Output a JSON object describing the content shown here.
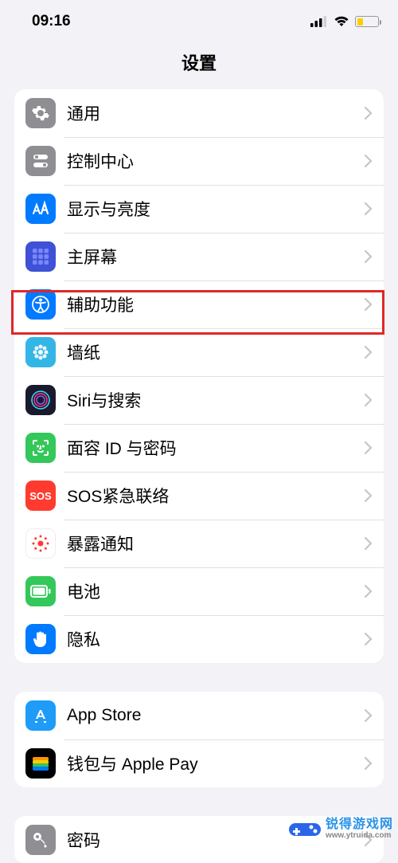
{
  "status": {
    "time": "09:16"
  },
  "header": {
    "title": "设置"
  },
  "rows": {
    "general": {
      "label": "通用"
    },
    "controlCenter": {
      "label": "控制中心"
    },
    "display": {
      "label": "显示与亮度"
    },
    "homeScreen": {
      "label": "主屏幕"
    },
    "accessibility": {
      "label": "辅助功能"
    },
    "wallpaper": {
      "label": "墙纸"
    },
    "siri": {
      "label": "Siri与搜索"
    },
    "faceid": {
      "label": "面容 ID 与密码"
    },
    "sos": {
      "label": "SOS紧急联络"
    },
    "exposure": {
      "label": "暴露通知"
    },
    "battery": {
      "label": "电池"
    },
    "privacy": {
      "label": "隐私"
    },
    "appstore": {
      "label": "App Store"
    },
    "wallet": {
      "label": "钱包与 Apple Pay"
    },
    "passwords": {
      "label": "密码"
    }
  },
  "watermark": {
    "top": "锐得游戏网",
    "bottom": "www.ytruida.com"
  }
}
